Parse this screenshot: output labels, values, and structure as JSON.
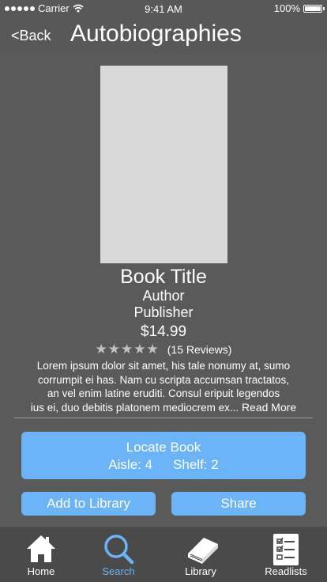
{
  "status_bar": {
    "carrier": "Carrier",
    "time": "9:41 AM",
    "battery": "100%"
  },
  "nav": {
    "back_label": "Back",
    "title": "Autobiographies"
  },
  "book": {
    "title": "Book Title",
    "author": "Author",
    "publisher": "Publisher",
    "price": "$14.99",
    "stars": "★★★★★",
    "reviews": "(15 Reviews)",
    "description_lines": [
      "Lorem ipsum dolor sit amet, his tale nonumy at, sumo",
      "corrumpit ei has. Nam cu scripta accumsan tractatos,",
      "an vel enim latine eruditi. Consul eripuit legendos",
      "ius ei, duo debitis platonem mediocrem ex..."
    ],
    "read_more": "Read More"
  },
  "locate": {
    "title": "Locate Book",
    "aisle": "Aisle: 4",
    "shelf": "Shelf: 2"
  },
  "actions": {
    "add_label": "Add to Library",
    "share_label": "Share"
  },
  "tabs": [
    {
      "label": "Home",
      "icon": "home-icon"
    },
    {
      "label": "Search",
      "icon": "search-icon",
      "active": true
    },
    {
      "label": "Library",
      "icon": "book-icon"
    },
    {
      "label": "Readlists",
      "icon": "checklist-icon"
    }
  ],
  "colors": {
    "accent": "#6cb4f8",
    "background": "#5a5a5a",
    "tabbar": "#4a4a4a"
  }
}
